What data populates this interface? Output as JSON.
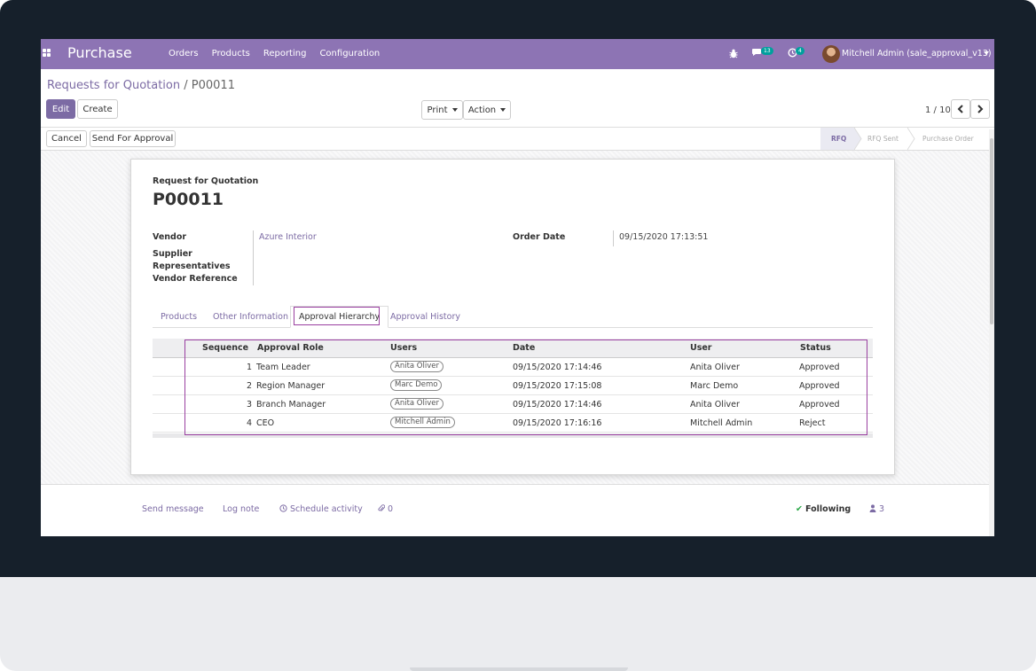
{
  "app": {
    "brand": "Purchase",
    "menu": [
      "Orders",
      "Products",
      "Reporting",
      "Configuration"
    ],
    "messages_count": "13",
    "activities_count": "4",
    "user": "Mitchell Admin (sale_approval_v13)"
  },
  "breadcrumb": {
    "parent": "Requests for Quotation",
    "separator": "/",
    "current": "P00011"
  },
  "buttons": {
    "edit": "Edit",
    "create": "Create",
    "print": "Print",
    "action": "Action",
    "cancel": "Cancel",
    "send_for_approval": "Send For Approval"
  },
  "pager": {
    "value": "1 / 10"
  },
  "stages": [
    "RFQ",
    "RFQ Sent",
    "Purchase Order"
  ],
  "active_stage": "RFQ",
  "document": {
    "subtitle": "Request for Quotation",
    "name": "P00011",
    "fields": {
      "vendor_label": "Vendor",
      "vendor_value": "Azure Interior",
      "supplier_reps_label": "Supplier Representatives",
      "vendor_ref_label": "Vendor Reference",
      "order_date_label": "Order Date",
      "order_date_value": "09/15/2020 17:13:51"
    }
  },
  "tabs": [
    "Products",
    "Other Information",
    "Approval Hierarchy",
    "Approval History"
  ],
  "active_tab": "Approval Hierarchy",
  "approval_table": {
    "headers": [
      "Sequence",
      "Approval Role",
      "Users",
      "Date",
      "User",
      "Status"
    ],
    "rows": [
      {
        "sequence": "1",
        "role": "Team Leader",
        "users": "Anita Oliver",
        "date": "09/15/2020 17:14:46",
        "user": "Anita Oliver",
        "status": "Approved"
      },
      {
        "sequence": "2",
        "role": "Region Manager",
        "users": "Marc Demo",
        "date": "09/15/2020 17:15:08",
        "user": "Marc Demo",
        "status": "Approved"
      },
      {
        "sequence": "3",
        "role": "Branch Manager",
        "users": "Anita Oliver",
        "date": "09/15/2020 17:14:46",
        "user": "Anita Oliver",
        "status": "Approved"
      },
      {
        "sequence": "4",
        "role": "CEO",
        "users": "Mitchell Admin",
        "date": "09/15/2020 17:16:16",
        "user": "Mitchell Admin",
        "status": "Reject"
      }
    ]
  },
  "chatter": {
    "send_message": "Send message",
    "log_note": "Log note",
    "schedule_activity": "Schedule activity",
    "attachments": "0",
    "following": "Following",
    "followers": "3"
  },
  "colors": {
    "navbar": "#8d74b4",
    "primary": "#7c6ba4",
    "highlight": "#9a3fa0"
  }
}
